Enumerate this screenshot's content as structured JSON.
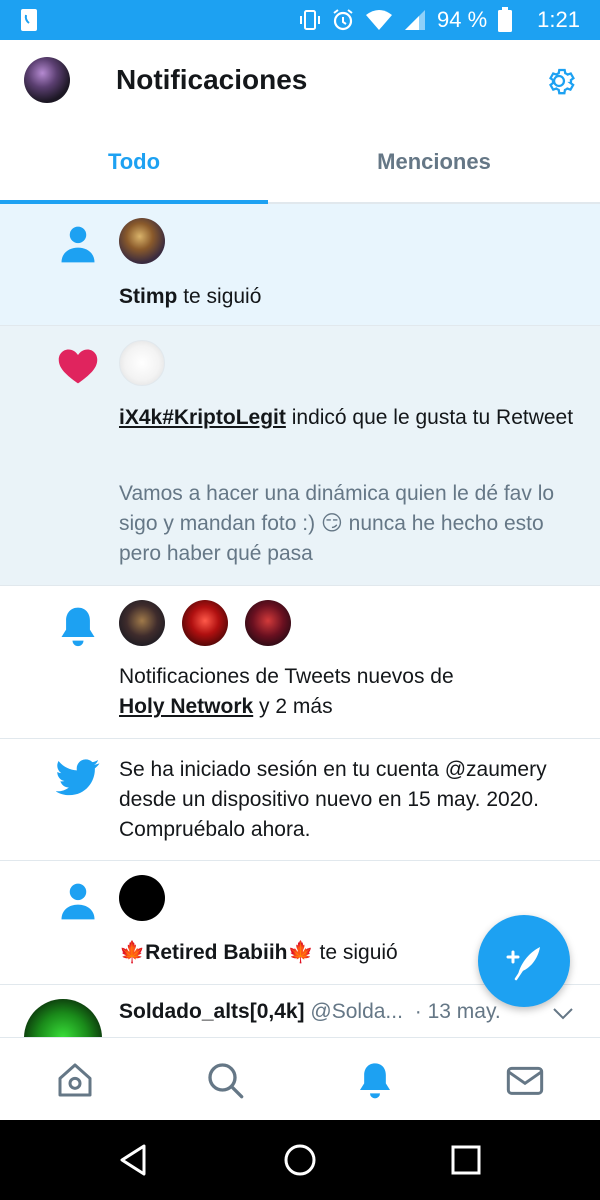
{
  "status_bar": {
    "battery_percent": "94 %",
    "time": "1:21"
  },
  "header": {
    "title": "Notificaciones"
  },
  "tabs": [
    {
      "label": "Todo",
      "active": true
    },
    {
      "label": "Menciones",
      "active": false
    }
  ],
  "notifications": [
    {
      "type": "follow",
      "icon": "person-icon",
      "user": "Stimp",
      "text": "te siguió"
    },
    {
      "type": "like",
      "icon": "heart-icon",
      "user": "iX4k#KriptoLegit",
      "text": "indicó que le gusta tu Retweet",
      "tweet_text": "Vamos a hacer una dinámica quien le dé fav lo sigo y mandan foto :) 😏 nunca he hecho esto pero haber qué pasa"
    },
    {
      "type": "tweet_notifications",
      "icon": "bell-icon",
      "text_before": "Notificaciones de Tweets nuevos de",
      "user": "Holy Network",
      "text_after": "y 2 más"
    },
    {
      "type": "login",
      "icon": "twitter-bird-icon",
      "text": "Se ha iniciado sesión en tu cuenta @zaumery desde un dispositivo nuevo en 15 may. 2020. Compruébalo ahora."
    },
    {
      "type": "follow",
      "icon": "person-icon",
      "user": "🍁Retired Babiih🍁",
      "text": "te siguió"
    }
  ],
  "tweet_preview": {
    "name": "Soldado_alts[0,4k]",
    "handle": "@Solda...",
    "date": "· 13 may."
  },
  "colors": {
    "accent": "#1da1f2",
    "like": "#e0245e",
    "secondary_text": "#657786"
  }
}
